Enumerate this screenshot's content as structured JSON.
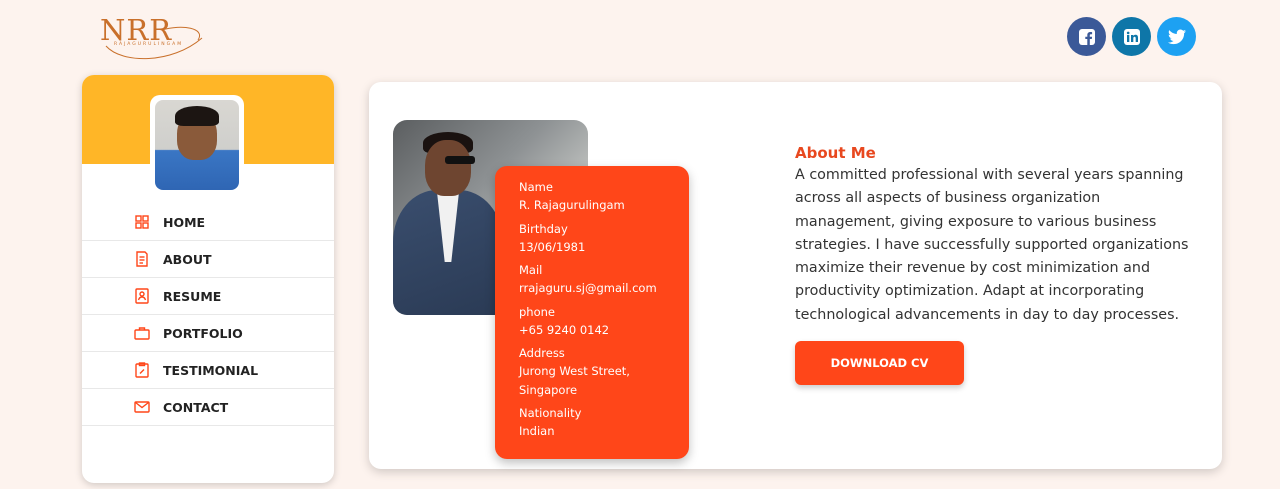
{
  "logo": {
    "text": "NRR",
    "subtitle": "RAJAGURULINGAM"
  },
  "social": [
    {
      "icon": "facebook-icon",
      "color": "#3b5998"
    },
    {
      "icon": "linkedin-icon",
      "color": "#0e76a8"
    },
    {
      "icon": "twitter-icon",
      "color": "#1da1f2"
    }
  ],
  "sidebar": {
    "header_color": "#ffb627",
    "items": [
      {
        "label": "HOME",
        "icon": "home-grid-icon"
      },
      {
        "label": "ABOUT",
        "icon": "document-icon"
      },
      {
        "label": "RESUME",
        "icon": "resume-icon"
      },
      {
        "label": "PORTFOLIO",
        "icon": "briefcase-icon"
      },
      {
        "label": "TESTIMONIAL",
        "icon": "clipboard-edit-icon"
      },
      {
        "label": "CONTACT",
        "icon": "envelope-icon"
      }
    ]
  },
  "info": {
    "name_label": "Name",
    "name": "R. Rajagurulingam",
    "birthday_label": "Birthday",
    "birthday": "13/06/1981",
    "mail_label": "Mail",
    "mail": "rrajaguru.sj@gmail.com",
    "phone_label": "phone",
    "phone": "+65 9240 0142",
    "address_label": "Address",
    "address_line1": "Jurong West Street,",
    "address_line2": "Singapore",
    "nationality_label": "Nationality",
    "nationality": "Indian"
  },
  "about": {
    "title": "About Me",
    "lines": [
      "A committed professional with several years spanning",
      "across all aspects of business organization",
      "management, giving exposure to various business",
      "strategies. I have successfully supported organizations",
      "maximize their revenue by cost minimization and",
      "productivity optimization. Adapt at incorporating",
      "technological advancements in day to day processes."
    ],
    "button_label": "DOWNLOAD CV"
  },
  "colors": {
    "accent": "#ff4619",
    "background": "#fdf3ee"
  }
}
